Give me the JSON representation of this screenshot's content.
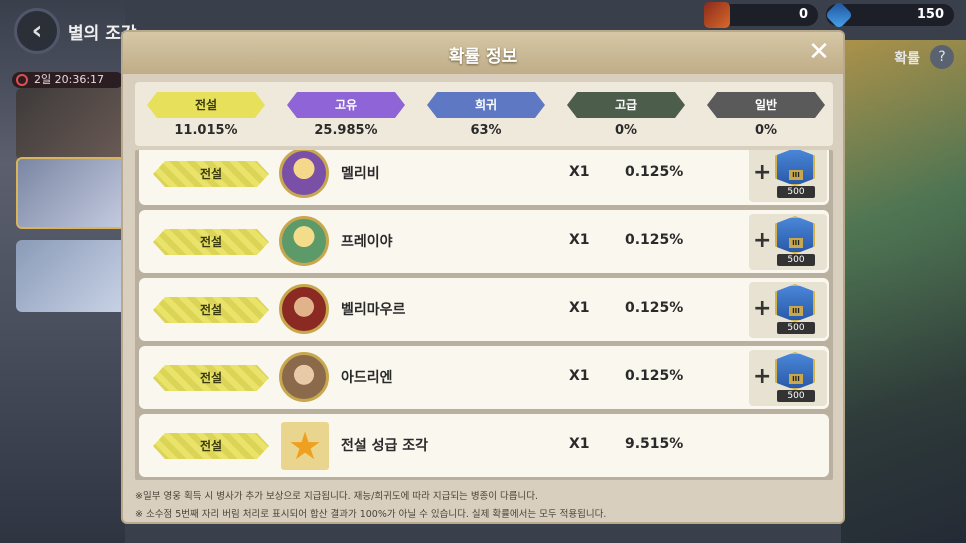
{
  "header": {
    "title": "별의 조각",
    "timer": "2일 20:36:17",
    "currency_1": "0",
    "currency_2": "150",
    "probability_link": "확률"
  },
  "modal": {
    "title": "확률 정보",
    "close_label": "✕",
    "summary": [
      {
        "label": "전설",
        "value": "11.015%",
        "color": "#e7e05a"
      },
      {
        "label": "고유",
        "value": "25.985%",
        "color": "#8e64d6"
      },
      {
        "label": "희귀",
        "value": "63%",
        "color": "#5f78c4"
      },
      {
        "label": "고급",
        "value": "0%",
        "color": "#4d5d4b"
      },
      {
        "label": "일반",
        "value": "0%",
        "color": "#5a5a5a"
      }
    ],
    "rows": [
      {
        "grade": "전설",
        "name": "멜리비",
        "qty": "X1",
        "rate": "0.125%",
        "bonus_plus": "+",
        "bonus_rank": "III",
        "bonus_count": "500"
      },
      {
        "grade": "전설",
        "name": "프레이야",
        "qty": "X1",
        "rate": "0.125%",
        "bonus_plus": "+",
        "bonus_rank": "III",
        "bonus_count": "500"
      },
      {
        "grade": "전설",
        "name": "벨리마우르",
        "qty": "X1",
        "rate": "0.125%",
        "bonus_plus": "+",
        "bonus_rank": "III",
        "bonus_count": "500"
      },
      {
        "grade": "전설",
        "name": "아드리엔",
        "qty": "X1",
        "rate": "0.125%",
        "bonus_plus": "+",
        "bonus_rank": "III",
        "bonus_count": "500"
      },
      {
        "grade": "전설",
        "name": "전설 성급 조각",
        "qty": "X1",
        "rate": "9.515%",
        "star": "★"
      }
    ],
    "notes": [
      "※일부 영웅 획득 시 병사가 추가 보상으로 지급됩니다. 재능/희귀도에 따라 지급되는 병종이 다릅니다.",
      "※ 소수점 5번째 자리 버림 처리로 표시되어 합산 결과가 100%가 아닐 수 있습니다. 실제 확률에서는 모두 적용됩니다."
    ]
  }
}
